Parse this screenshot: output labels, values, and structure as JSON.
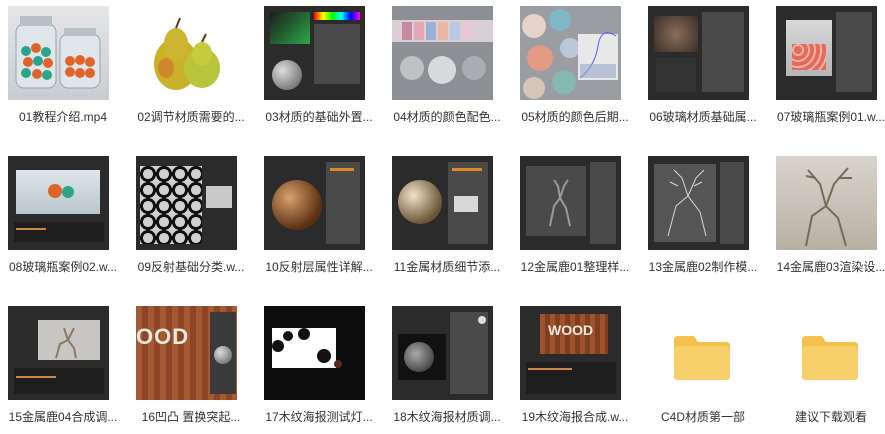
{
  "files": [
    {
      "label": "01教程介绍.mp4",
      "thumb": "jars-icon"
    },
    {
      "label": "02调节材质需要的...",
      "thumb": "pears-icon"
    },
    {
      "label": "03材质的基础外置...",
      "thumb": "c4d-material-editor"
    },
    {
      "label": "04材质的颜色配色...",
      "thumb": "color-palette-spheres"
    },
    {
      "label": "05材质的颜色后期...",
      "thumb": "color-circles-curves"
    },
    {
      "label": "06玻璃材质基础属...",
      "thumb": "glass-material-editor"
    },
    {
      "label": "07玻璃瓶案例01.w...",
      "thumb": "glass-jar-render"
    },
    {
      "label": "08玻璃瓶案例02.w...",
      "thumb": "glass-jar-scene"
    },
    {
      "label": "09反射基础分类.w...",
      "thumb": "reflection-spheres-grid"
    },
    {
      "label": "10反射层属性详解...",
      "thumb": "reflection-sphere"
    },
    {
      "label": "11金属材质细节添...",
      "thumb": "metal-sphere"
    },
    {
      "label": "12金属鹿01整理样...",
      "thumb": "metal-deer-viewport"
    },
    {
      "label": "13金属鹿02制作模...",
      "thumb": "deer-wireframe"
    },
    {
      "label": "14金属鹿03渲染设...",
      "thumb": "deer-render"
    },
    {
      "label": "15金属鹿04合成调...",
      "thumb": "deer-composite"
    },
    {
      "label": "16凹凸 置换突起...",
      "thumb": "wood-text"
    },
    {
      "label": "17木纹海报测试灯...",
      "thumb": "poster-light-test"
    },
    {
      "label": "18木纹海报材质调...",
      "thumb": "poster-material"
    },
    {
      "label": "19木纹海报合成.w...",
      "thumb": "wood-poster-composite"
    },
    {
      "label": "C4D材质第一部",
      "thumb": "folder-icon"
    },
    {
      "label": "建议下载观看",
      "thumb": "folder-icon"
    }
  ],
  "colors": {
    "folder": "#f8d06b",
    "folder_tab": "#f2c14e",
    "ui_dark": "#2b2b2b",
    "accent": "#d98a2b"
  }
}
